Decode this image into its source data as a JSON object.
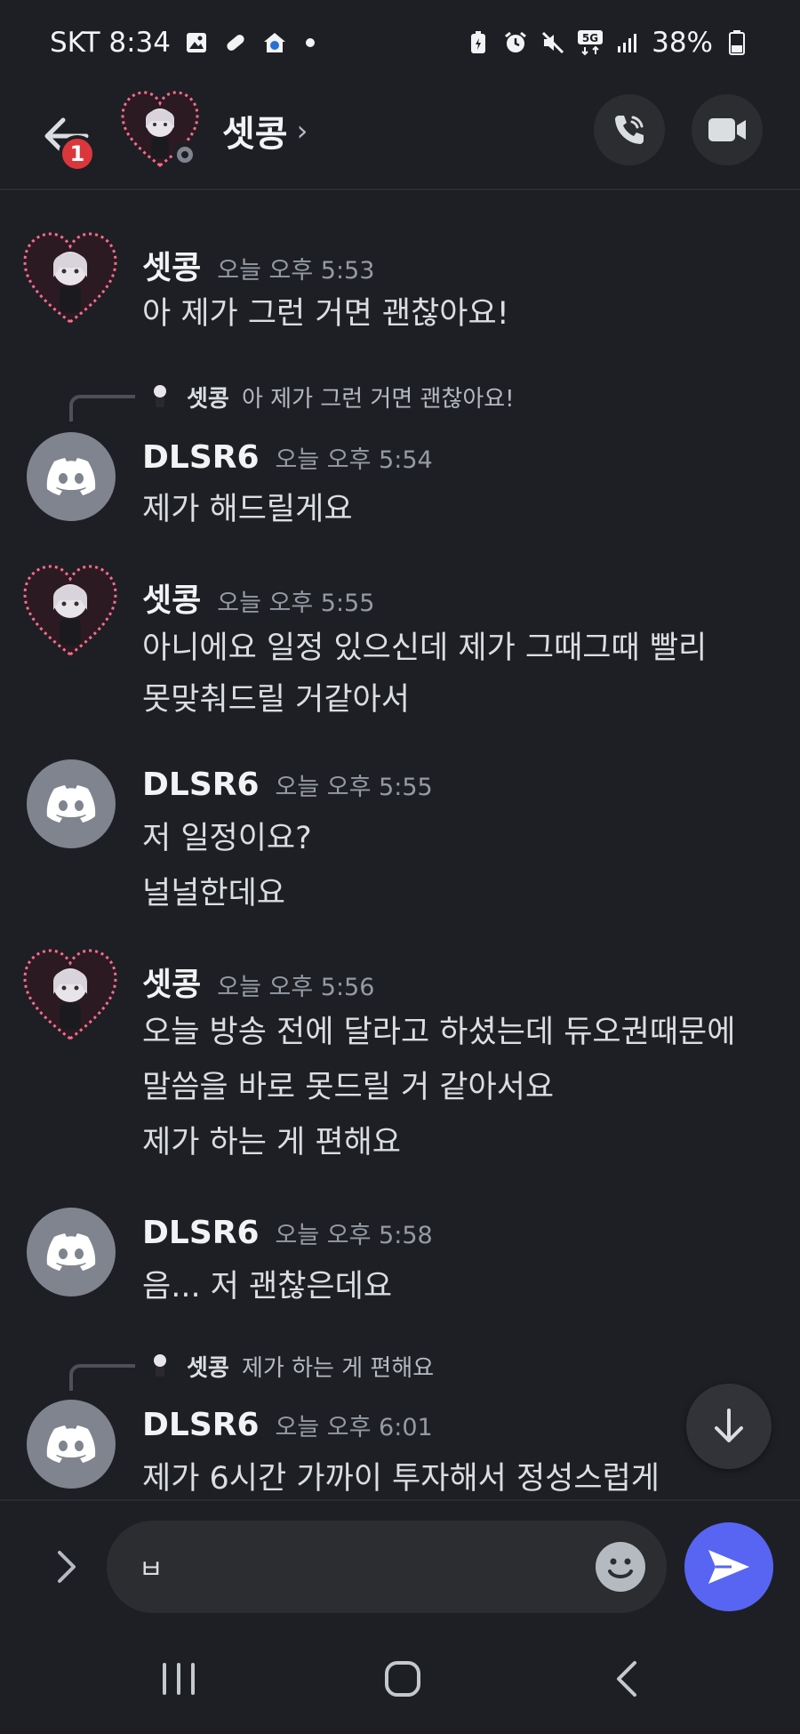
{
  "status_bar": {
    "carrier_time": "SKT 8:34",
    "battery": "38%",
    "left_icons": [
      "gallery-icon",
      "pill-icon",
      "home-app-icon",
      "dot-indicator"
    ],
    "right_icons": [
      "battery-saver-icon",
      "alarm-icon",
      "mute-icon",
      "5g-icon",
      "signal-icon",
      "battery-icon"
    ]
  },
  "header": {
    "title": "셋콩",
    "unread_count": "1",
    "status": "offline"
  },
  "messages": [
    {
      "author": "셋콩",
      "time": "오늘 오후 5:53",
      "lines": [
        "아 제가 그런 거면 괜찮아요!"
      ]
    },
    {
      "reply_to": {
        "author": "셋콩",
        "text": "아 제가 그런 거면 괜찮아요!"
      },
      "author": "DLSR6",
      "time": "오늘 오후 5:54",
      "lines": [
        "제가 해드릴게요"
      ]
    },
    {
      "author": "셋콩",
      "time": "오늘 오후 5:55",
      "lines": [
        "아니에요 일정 있으신데 제가 그때그때 빨리",
        "못맞춰드릴 거같아서"
      ]
    },
    {
      "author": "DLSR6",
      "time": "오늘 오후 5:55",
      "lines": [
        "저 일정이요?",
        "널널한데요"
      ]
    },
    {
      "author": "셋콩",
      "time": "오늘 오후 5:56",
      "lines": [
        "오늘 방송 전에 달라고 하셨는데 듀오권때문에",
        "말씀을 바로 못드릴 거 같아서요",
        "제가 하는 게 편해요"
      ]
    },
    {
      "author": "DLSR6",
      "time": "오늘 오후 5:58",
      "lines": [
        "음... 저 괜찮은데요"
      ]
    },
    {
      "reply_to": {
        "author": "셋콩",
        "text": "제가 하는 게 편해요"
      },
      "author": "DLSR6",
      "time": "오늘 오후 6:01",
      "lines": [
        "제가 6시간 가까이 투자해서 정성스럽게"
      ]
    }
  ],
  "composer": {
    "value": "ㅂ"
  },
  "colors": {
    "background": "#1e1f24",
    "accent": "#5865f2",
    "badge": "#da373c"
  }
}
